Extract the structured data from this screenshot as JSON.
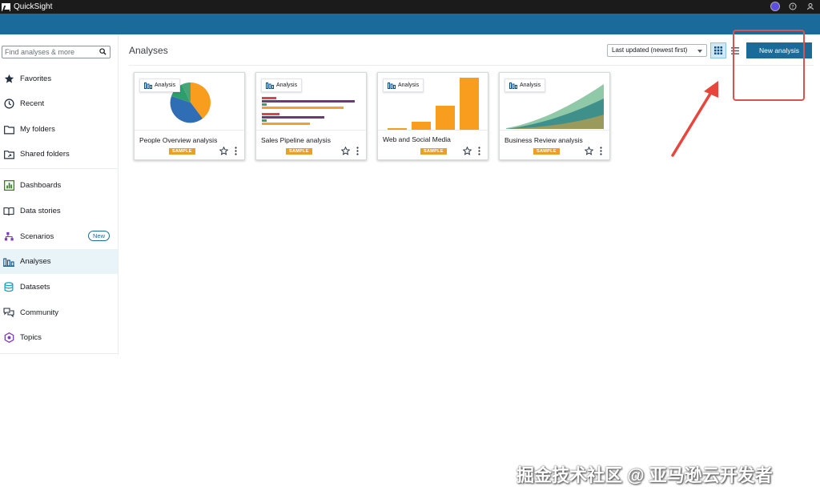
{
  "app": {
    "name": "QuickSight"
  },
  "search": {
    "placeholder": "Find analyses & more"
  },
  "sidebar": {
    "items": [
      {
        "label": "Favorites",
        "icon": "star-filled-icon"
      },
      {
        "label": "Recent",
        "icon": "clock-icon"
      },
      {
        "label": "My folders",
        "icon": "folder-icon"
      },
      {
        "label": "Shared folders",
        "icon": "shared-folder-icon"
      },
      {
        "label": "Dashboards",
        "icon": "dashboard-icon"
      },
      {
        "label": "Data stories",
        "icon": "book-icon"
      },
      {
        "label": "Scenarios",
        "icon": "scenario-icon",
        "badge": "New"
      },
      {
        "label": "Analyses",
        "icon": "analysis-icon",
        "active": true
      },
      {
        "label": "Datasets",
        "icon": "dataset-icon"
      },
      {
        "label": "Community",
        "icon": "community-icon"
      },
      {
        "label": "Topics",
        "icon": "topics-icon"
      }
    ]
  },
  "main": {
    "title": "Analyses",
    "sort_label": "Last updated (newest first)",
    "new_button": "New analysis",
    "cards": [
      {
        "tag": "Analysis",
        "title": "People Overview analysis",
        "badge": "SAMPLE"
      },
      {
        "tag": "Analysis",
        "title": "Sales Pipeline analysis",
        "badge": "SAMPLE"
      },
      {
        "tag": "Analysis",
        "title": "Web and Social Media",
        "badge": "SAMPLE"
      },
      {
        "tag": "Analysis",
        "title": "Business Review analysis",
        "badge": "SAMPLE"
      }
    ]
  },
  "colors": {
    "brand": "#1a6b99",
    "sample_badge": "#e9a02b",
    "annotation": "#d9524f"
  },
  "watermark": "掘金技术社区 @ 亚马逊云开发者"
}
